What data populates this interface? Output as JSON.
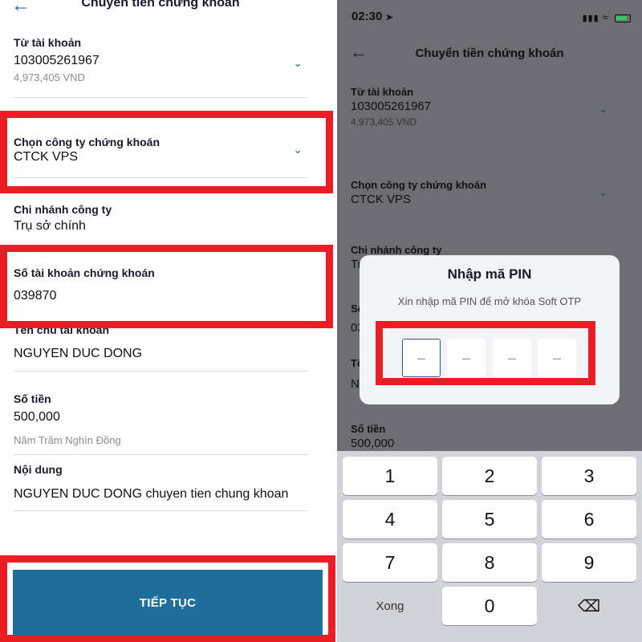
{
  "left": {
    "title": "Chuyển tiền chứng khoán",
    "back_icon": "back-arrow-icon",
    "from_account": {
      "label": "Từ tài khoản",
      "value": "103005261967",
      "balance": "4,973,405 VND"
    },
    "company": {
      "label": "Chọn công ty chứng khoán",
      "value": "CTCK VPS"
    },
    "branch": {
      "label": "Chi nhánh công ty",
      "value": "Trụ sở chính"
    },
    "securities_account": {
      "label": "Số tài khoản chứng khoán",
      "value": "039870"
    },
    "account_holder": {
      "label": "Tên chủ tài khoản",
      "value": "NGUYEN DUC DONG"
    },
    "amount": {
      "label": "Số tiền",
      "value": "500,000",
      "in_words": "Năm Trăm Nghìn Đồng"
    },
    "content": {
      "label": "Nội dung",
      "value": "NGUYEN DUC DONG chuyen tien chung khoan"
    },
    "continue_button": "TIẾP TỤC",
    "highlight_color": "#ee1c25",
    "accent_color": "#1f6f9c"
  },
  "right": {
    "status_time": "02:30",
    "title": "Chuyển tiền chứng khoán",
    "from_account": {
      "label": "Từ tài khoản",
      "value": "103005261967",
      "balance": "4,973,405 VND"
    },
    "company": {
      "label": "Chọn công ty chứng khoán",
      "value": "CTCK VPS"
    },
    "branch": {
      "label": "Chi nhánh công ty",
      "value": "Tr"
    },
    "partial_label_1": "Số",
    "partial_value_1": "03",
    "partial_label_2": "Tê",
    "partial_value_2": "N",
    "amount": {
      "label": "Số tiền",
      "value": "500,000"
    },
    "modal": {
      "title": "Nhập mã PIN",
      "subtitle": "Xin nhập mã PIN để mở khóa Soft OTP",
      "pin_placeholders": [
        "–",
        "–",
        "–",
        "–"
      ]
    },
    "keypad": {
      "keys": [
        "1",
        "2",
        "3",
        "4",
        "5",
        "6",
        "7",
        "8",
        "9"
      ],
      "done": "Xong",
      "zero": "0",
      "backspace": "⌫"
    }
  }
}
